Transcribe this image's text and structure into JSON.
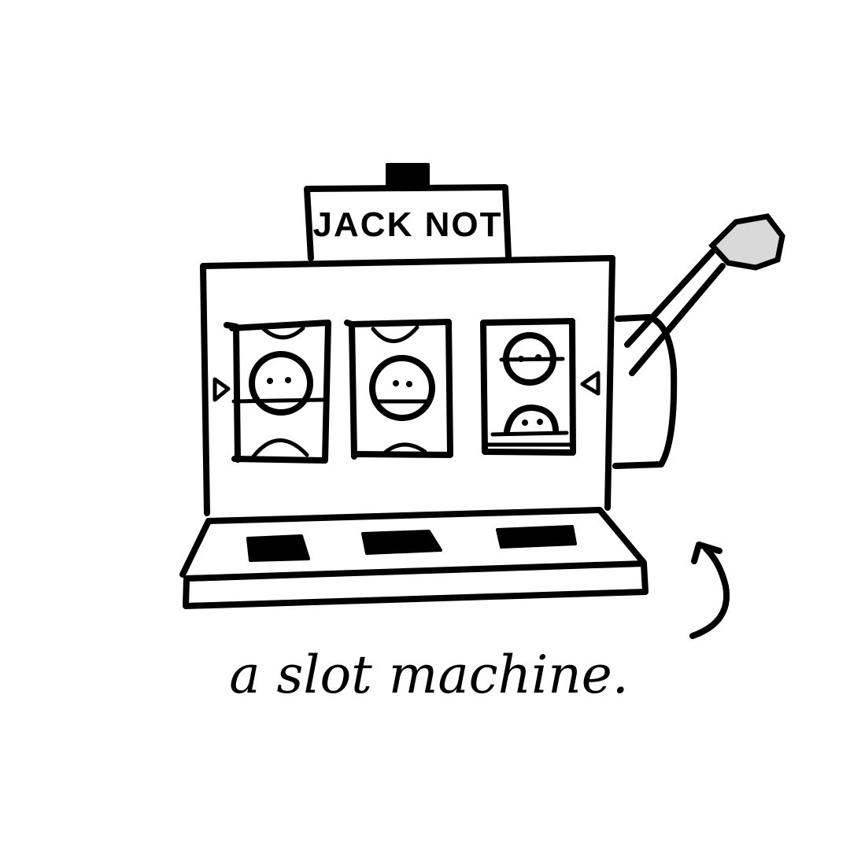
{
  "sign": {
    "text": "JACK NOT"
  },
  "caption": {
    "text": "a slot machine."
  },
  "colors": {
    "ink": "#000000",
    "paper": "#ffffff",
    "knob_fill": "#d9d9d9"
  },
  "icons": [
    "coin-slot-icon",
    "lever-icon",
    "curved-arrow-icon",
    "smiley-face-icon"
  ]
}
